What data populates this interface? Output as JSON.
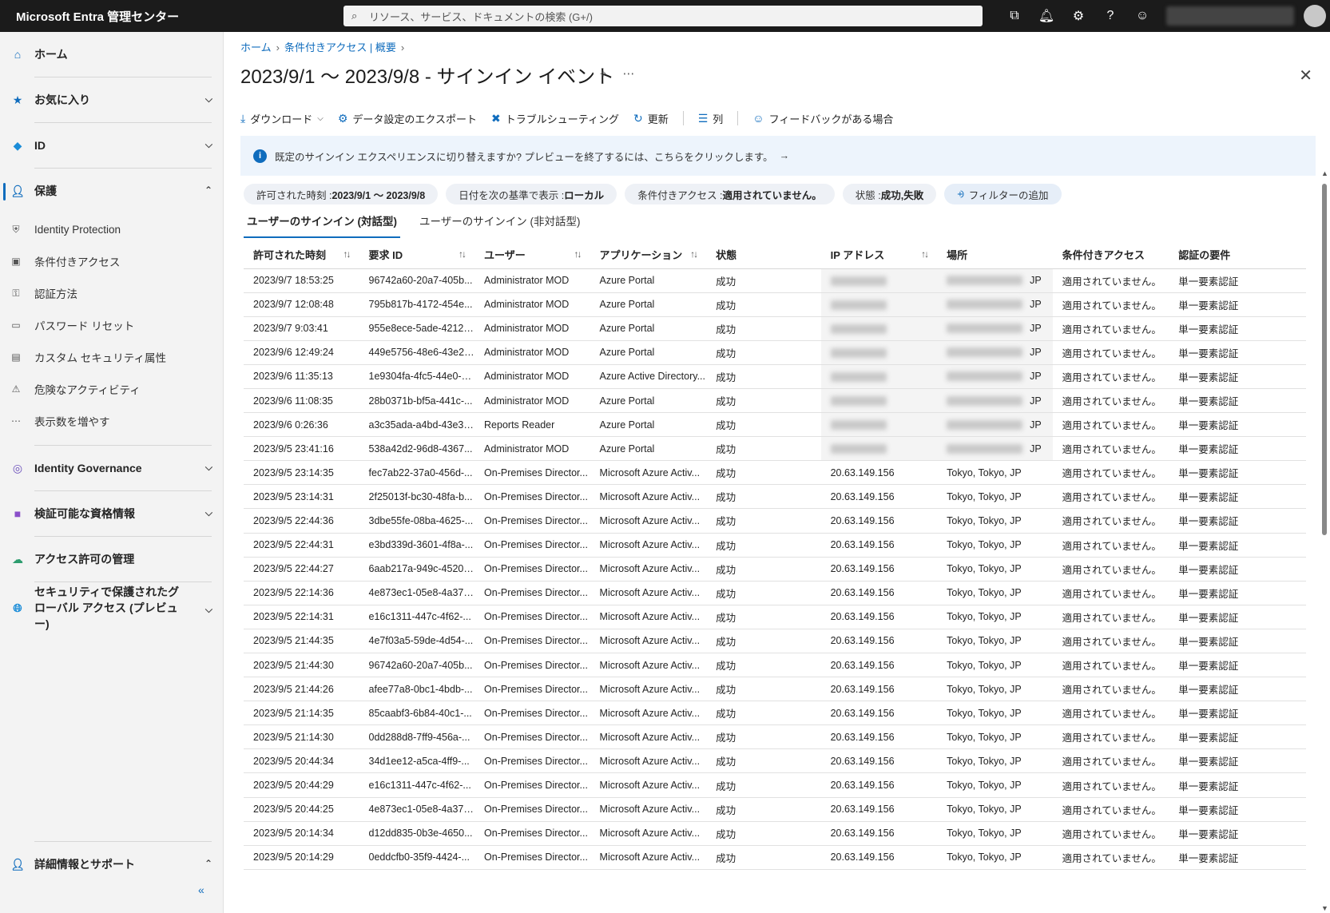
{
  "topbar": {
    "brand": "Microsoft Entra 管理センター",
    "search_placeholder": "リソース、サービス、ドキュメントの検索 (G+/)",
    "icons": [
      "portal-switch-icon",
      "bell-icon",
      "gear-icon",
      "help-icon",
      "feedback-icon"
    ]
  },
  "sidebar": {
    "home": "ホーム",
    "favorites": "お気に入り",
    "id": "ID",
    "protection": "保護",
    "protection_items": [
      {
        "label": "Identity Protection",
        "icon": "shield-icon"
      },
      {
        "label": "条件付きアクセス",
        "icon": "conditional-access-icon"
      },
      {
        "label": "認証方法",
        "icon": "key-icon"
      },
      {
        "label": "パスワード リセット",
        "icon": "password-icon"
      },
      {
        "label": "カスタム セキュリティ属性",
        "icon": "attribute-icon"
      },
      {
        "label": "危険なアクティビティ",
        "icon": "risky-users-icon"
      },
      {
        "label": "表示数を増やす",
        "icon": "more-icon"
      }
    ],
    "identity_governance": "Identity Governance",
    "verifiable_credentials": "検証可能な資格情報",
    "permissions_management": "アクセス許可の管理",
    "global_secure_access": "セキュリティで保護されたグローバル アクセス (プレビュー)",
    "learn_support": "詳細情報とサポート"
  },
  "breadcrumb": {
    "home": "ホーム",
    "ca": "条件付きアクセス | 概要"
  },
  "page_title": "2023/9/1 〜 2023/9/8 - サインイン イベント",
  "toolbar": {
    "download": "ダウンロード",
    "export": "データ設定のエクスポート",
    "troubleshoot": "トラブルシューティング",
    "refresh": "更新",
    "columns": "列",
    "feedback": "フィードバックがある場合"
  },
  "banner": {
    "text": "既定のサインイン エクスペリエンスに切り替えますか? プレビューを終了するには、こちらをクリックします。"
  },
  "filters": {
    "date_label": "許可された時刻 : ",
    "date_value": "2023/9/1 〜 2023/9/8",
    "tz_label": "日付を次の基準で表示 : ",
    "tz_value": "ローカル",
    "ca_label": "条件付きアクセス : ",
    "ca_value": "適用されていません。",
    "status_label": "状態 : ",
    "status_value": "成功,失敗",
    "add": "フィルターの追加"
  },
  "tabs": [
    "ユーザーのサインイン (対話型)",
    "ユーザーのサインイン (非対話型)"
  ],
  "table": {
    "headers": [
      "許可された時刻",
      "要求 ID",
      "ユーザー",
      "アプリケーション",
      "状態",
      "IP アドレス",
      "場所",
      "条件付きアクセス",
      "認証の要件"
    ],
    "rows": [
      {
        "time": "2023/9/7 18:53:25",
        "id": "96742a60-20a7-405b...",
        "user": "Administrator MOD",
        "app": "Azure Portal",
        "status": "成功",
        "ip": "",
        "loc": "JP",
        "ca": "適用されていません。",
        "auth": "単一要素認証"
      },
      {
        "time": "2023/9/7 12:08:48",
        "id": "795b817b-4172-454e...",
        "user": "Administrator MOD",
        "app": "Azure Portal",
        "status": "成功",
        "ip": "",
        "loc": "JP",
        "ca": "適用されていません。",
        "auth": "単一要素認証"
      },
      {
        "time": "2023/9/7 9:03:41",
        "id": "955e8ece-5ade-4212-...",
        "user": "Administrator MOD",
        "app": "Azure Portal",
        "status": "成功",
        "ip": "",
        "loc": "JP",
        "ca": "適用されていません。",
        "auth": "単一要素認証"
      },
      {
        "time": "2023/9/6 12:49:24",
        "id": "449e5756-48e6-43e2-...",
        "user": "Administrator MOD",
        "app": "Azure Portal",
        "status": "成功",
        "ip": "",
        "loc": "JP",
        "ca": "適用されていません。",
        "auth": "単一要素認証"
      },
      {
        "time": "2023/9/6 11:35:13",
        "id": "1e9304fa-4fc5-44e0-8...",
        "user": "Administrator MOD",
        "app": "Azure Active Directory...",
        "status": "成功",
        "ip": "",
        "loc": "JP",
        "ca": "適用されていません。",
        "auth": "単一要素認証"
      },
      {
        "time": "2023/9/6 11:08:35",
        "id": "28b0371b-bf5a-441c-...",
        "user": "Administrator MOD",
        "app": "Azure Portal",
        "status": "成功",
        "ip": "",
        "loc": "JP",
        "ca": "適用されていません。",
        "auth": "単一要素認証"
      },
      {
        "time": "2023/9/6 0:26:36",
        "id": "a3c35ada-a4bd-43e3-...",
        "user": "Reports Reader",
        "app": "Azure Portal",
        "status": "成功",
        "ip": "",
        "loc": "JP",
        "ca": "適用されていません。",
        "auth": "単一要素認証"
      },
      {
        "time": "2023/9/5 23:41:16",
        "id": "538a42d2-96d8-4367...",
        "user": "Administrator MOD",
        "app": "Azure Portal",
        "status": "成功",
        "ip": "",
        "loc": "JP",
        "ca": "適用されていません。",
        "auth": "単一要素認証"
      },
      {
        "time": "2023/9/5 23:14:35",
        "id": "fec7ab22-37a0-456d-...",
        "user": "On-Premises Director...",
        "app": "Microsoft Azure Activ...",
        "status": "成功",
        "ip": "20.63.149.156",
        "loc": "Tokyo, Tokyo, JP",
        "ca": "適用されていません。",
        "auth": "単一要素認証"
      },
      {
        "time": "2023/9/5 23:14:31",
        "id": "2f25013f-bc30-48fa-b...",
        "user": "On-Premises Director...",
        "app": "Microsoft Azure Activ...",
        "status": "成功",
        "ip": "20.63.149.156",
        "loc": "Tokyo, Tokyo, JP",
        "ca": "適用されていません。",
        "auth": "単一要素認証"
      },
      {
        "time": "2023/9/5 22:44:36",
        "id": "3dbe55fe-08ba-4625-...",
        "user": "On-Premises Director...",
        "app": "Microsoft Azure Activ...",
        "status": "成功",
        "ip": "20.63.149.156",
        "loc": "Tokyo, Tokyo, JP",
        "ca": "適用されていません。",
        "auth": "単一要素認証"
      },
      {
        "time": "2023/9/5 22:44:31",
        "id": "e3bd339d-3601-4f8a-...",
        "user": "On-Premises Director...",
        "app": "Microsoft Azure Activ...",
        "status": "成功",
        "ip": "20.63.149.156",
        "loc": "Tokyo, Tokyo, JP",
        "ca": "適用されていません。",
        "auth": "単一要素認証"
      },
      {
        "time": "2023/9/5 22:44:27",
        "id": "6aab217a-949c-4520-...",
        "user": "On-Premises Director...",
        "app": "Microsoft Azure Activ...",
        "status": "成功",
        "ip": "20.63.149.156",
        "loc": "Tokyo, Tokyo, JP",
        "ca": "適用されていません。",
        "auth": "単一要素認証"
      },
      {
        "time": "2023/9/5 22:14:36",
        "id": "4e873ec1-05e8-4a37-...",
        "user": "On-Premises Director...",
        "app": "Microsoft Azure Activ...",
        "status": "成功",
        "ip": "20.63.149.156",
        "loc": "Tokyo, Tokyo, JP",
        "ca": "適用されていません。",
        "auth": "単一要素認証"
      },
      {
        "time": "2023/9/5 22:14:31",
        "id": "e16c1311-447c-4f62-...",
        "user": "On-Premises Director...",
        "app": "Microsoft Azure Activ...",
        "status": "成功",
        "ip": "20.63.149.156",
        "loc": "Tokyo, Tokyo, JP",
        "ca": "適用されていません。",
        "auth": "単一要素認証"
      },
      {
        "time": "2023/9/5 21:44:35",
        "id": "4e7f03a5-59de-4d54-...",
        "user": "On-Premises Director...",
        "app": "Microsoft Azure Activ...",
        "status": "成功",
        "ip": "20.63.149.156",
        "loc": "Tokyo, Tokyo, JP",
        "ca": "適用されていません。",
        "auth": "単一要素認証"
      },
      {
        "time": "2023/9/5 21:44:30",
        "id": "96742a60-20a7-405b...",
        "user": "On-Premises Director...",
        "app": "Microsoft Azure Activ...",
        "status": "成功",
        "ip": "20.63.149.156",
        "loc": "Tokyo, Tokyo, JP",
        "ca": "適用されていません。",
        "auth": "単一要素認証"
      },
      {
        "time": "2023/9/5 21:44:26",
        "id": "afee77a8-0bc1-4bdb-...",
        "user": "On-Premises Director...",
        "app": "Microsoft Azure Activ...",
        "status": "成功",
        "ip": "20.63.149.156",
        "loc": "Tokyo, Tokyo, JP",
        "ca": "適用されていません。",
        "auth": "単一要素認証"
      },
      {
        "time": "2023/9/5 21:14:35",
        "id": "85caabf3-6b84-40c1-...",
        "user": "On-Premises Director...",
        "app": "Microsoft Azure Activ...",
        "status": "成功",
        "ip": "20.63.149.156",
        "loc": "Tokyo, Tokyo, JP",
        "ca": "適用されていません。",
        "auth": "単一要素認証"
      },
      {
        "time": "2023/9/5 21:14:30",
        "id": "0dd288d8-7ff9-456a-...",
        "user": "On-Premises Director...",
        "app": "Microsoft Azure Activ...",
        "status": "成功",
        "ip": "20.63.149.156",
        "loc": "Tokyo, Tokyo, JP",
        "ca": "適用されていません。",
        "auth": "単一要素認証"
      },
      {
        "time": "2023/9/5 20:44:34",
        "id": "34d1ee12-a5ca-4ff9-...",
        "user": "On-Premises Director...",
        "app": "Microsoft Azure Activ...",
        "status": "成功",
        "ip": "20.63.149.156",
        "loc": "Tokyo, Tokyo, JP",
        "ca": "適用されていません。",
        "auth": "単一要素認証"
      },
      {
        "time": "2023/9/5 20:44:29",
        "id": "e16c1311-447c-4f62-...",
        "user": "On-Premises Director...",
        "app": "Microsoft Azure Activ...",
        "status": "成功",
        "ip": "20.63.149.156",
        "loc": "Tokyo, Tokyo, JP",
        "ca": "適用されていません。",
        "auth": "単一要素認証"
      },
      {
        "time": "2023/9/5 20:44:25",
        "id": "4e873ec1-05e8-4a37-...",
        "user": "On-Premises Director...",
        "app": "Microsoft Azure Activ...",
        "status": "成功",
        "ip": "20.63.149.156",
        "loc": "Tokyo, Tokyo, JP",
        "ca": "適用されていません。",
        "auth": "単一要素認証"
      },
      {
        "time": "2023/9/5 20:14:34",
        "id": "d12dd835-0b3e-4650...",
        "user": "On-Premises Director...",
        "app": "Microsoft Azure Activ...",
        "status": "成功",
        "ip": "20.63.149.156",
        "loc": "Tokyo, Tokyo, JP",
        "ca": "適用されていません。",
        "auth": "単一要素認証"
      },
      {
        "time": "2023/9/5 20:14:29",
        "id": "0eddcfb0-35f9-4424-...",
        "user": "On-Premises Director...",
        "app": "Microsoft Azure Activ...",
        "status": "成功",
        "ip": "20.63.149.156",
        "loc": "Tokyo, Tokyo, JP",
        "ca": "適用されていません。",
        "auth": "単一要素認証"
      }
    ]
  },
  "colors": {
    "accent": "#0f6cbd",
    "topbar": "#1b1b1b",
    "sidebar": "#f3f3f3",
    "banner": "#edf4fc"
  }
}
